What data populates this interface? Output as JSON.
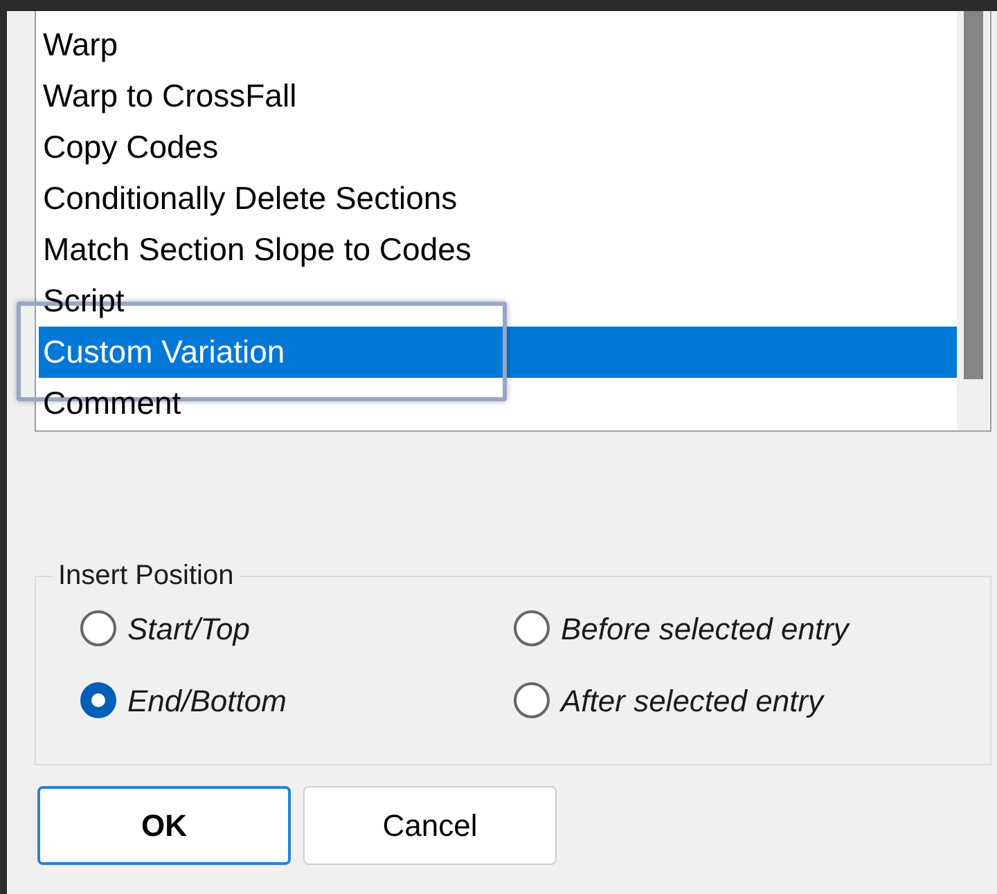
{
  "list": {
    "items": [
      {
        "label": "Warp",
        "selected": false
      },
      {
        "label": "Warp to CrossFall",
        "selected": false
      },
      {
        "label": "Copy Codes",
        "selected": false
      },
      {
        "label": "Conditionally Delete Sections",
        "selected": false
      },
      {
        "label": "Match Section Slope to Codes",
        "selected": false
      },
      {
        "label": "Script",
        "selected": false
      },
      {
        "label": "Custom Variation",
        "selected": true
      },
      {
        "label": "Comment",
        "selected": false
      }
    ]
  },
  "insert_position": {
    "title": "Insert Position",
    "options": [
      {
        "label": "Start/Top",
        "selected": false
      },
      {
        "label": "Before selected entry",
        "selected": false
      },
      {
        "label": "End/Bottom",
        "selected": true
      },
      {
        "label": "After selected entry",
        "selected": false
      }
    ]
  },
  "buttons": [
    {
      "label": "OK",
      "default": true
    },
    {
      "label": "Cancel",
      "default": false
    }
  ]
}
